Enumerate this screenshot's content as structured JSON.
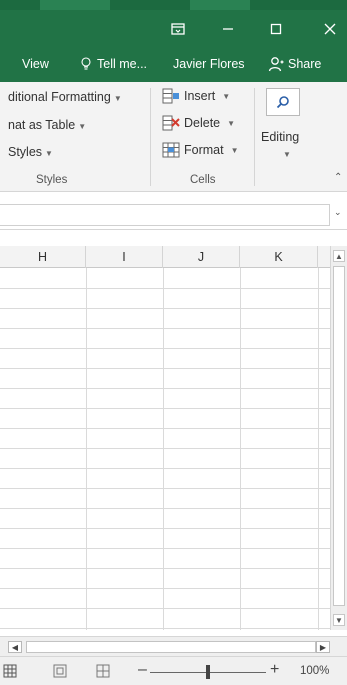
{
  "titlebar": {
    "buttons": [
      "ribbon-display-options",
      "minimize",
      "maximize",
      "close"
    ]
  },
  "tabs": {
    "view": "View",
    "tell_me": "Tell me...",
    "user": "Javier Flores",
    "share": "Share"
  },
  "ribbon": {
    "styles_group": {
      "conditional_formatting": "ditional Formatting",
      "format_as_table": "nat as Table",
      "cell_styles": "Styles",
      "label": "Styles"
    },
    "cells_group": {
      "insert": "Insert",
      "delete": "Delete",
      "format": "Format",
      "label": "Cells"
    },
    "editing": {
      "label": "Editing"
    }
  },
  "grid": {
    "columns": [
      "H",
      "I",
      "J",
      "K"
    ]
  },
  "status": {
    "zoom": "100%"
  },
  "colors": {
    "excel_green": "#217346",
    "ribbon_bg": "#f3f3f3"
  },
  "icons": [
    "ribbon-display-icon",
    "minimize-icon",
    "maximize-icon",
    "close-icon",
    "lightbulb-icon",
    "person-icon",
    "insert-cells-icon",
    "delete-cells-icon",
    "format-cells-icon",
    "search-icon",
    "collapse-ribbon-icon",
    "expand-formula-icon",
    "normal-view-icon",
    "page-layout-icon",
    "page-break-icon"
  ]
}
